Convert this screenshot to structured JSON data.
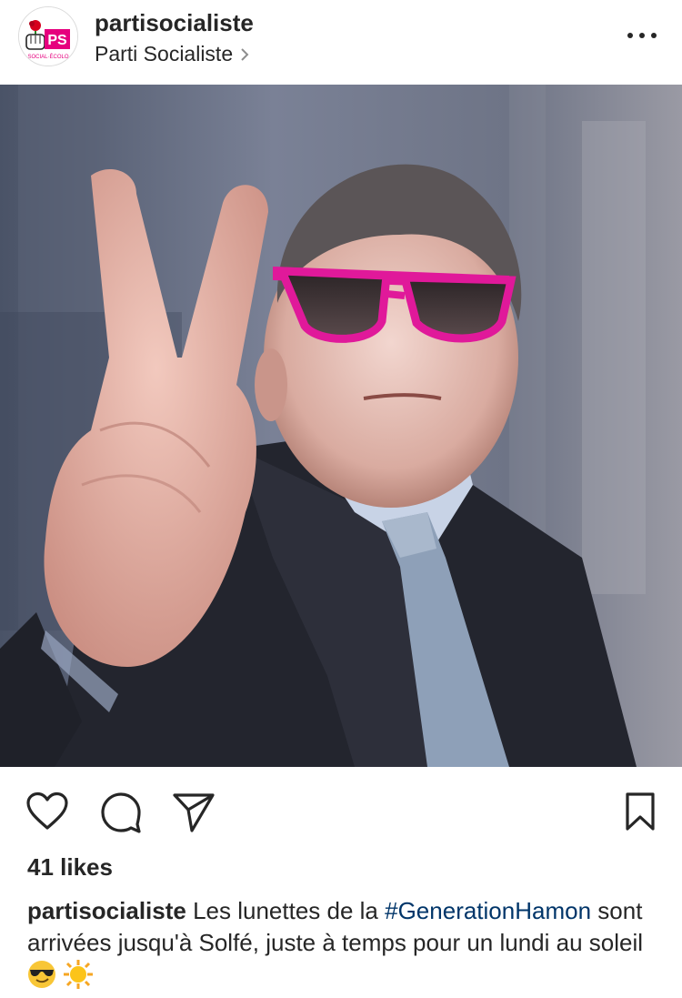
{
  "post": {
    "username": "partisocialiste",
    "account_name": "Parti Socialiste",
    "avatar_text": "PS",
    "avatar_subtext": "SOCIAL·ÉCOLO",
    "likes": "41 likes",
    "caption_user": "partisocialiste",
    "caption_before_tag": " Les lunettes de la ",
    "hashtag": "#GenerationHamon",
    "caption_after_tag": " sont arrivées jusqu'à Solfé, juste à temps pour un lundi au soleil ",
    "emojis": [
      "sunglasses-emoji",
      "sun-emoji"
    ]
  },
  "colors": {
    "text": "#262626",
    "hashtag": "#003569",
    "ps_pink": "#e6007e",
    "rose_red": "#d6001c",
    "glasses_magenta": "#e0199a"
  },
  "icons": {
    "more": "more-options-icon",
    "like": "heart-icon",
    "comment": "comment-icon",
    "share": "send-icon",
    "save": "bookmark-icon"
  }
}
